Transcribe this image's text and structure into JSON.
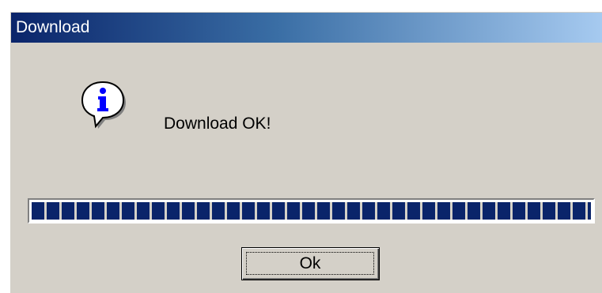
{
  "window": {
    "title": "Download"
  },
  "dialog": {
    "icon": "info-icon",
    "message": "Download OK!",
    "progress_fraction": 1.0,
    "ok_label": "Ok"
  },
  "colors": {
    "titlebar_start": "#0a246a",
    "titlebar_end": "#a6caf0",
    "progress_block": "#0a246a",
    "dialog_face": "#d4d0c8"
  }
}
